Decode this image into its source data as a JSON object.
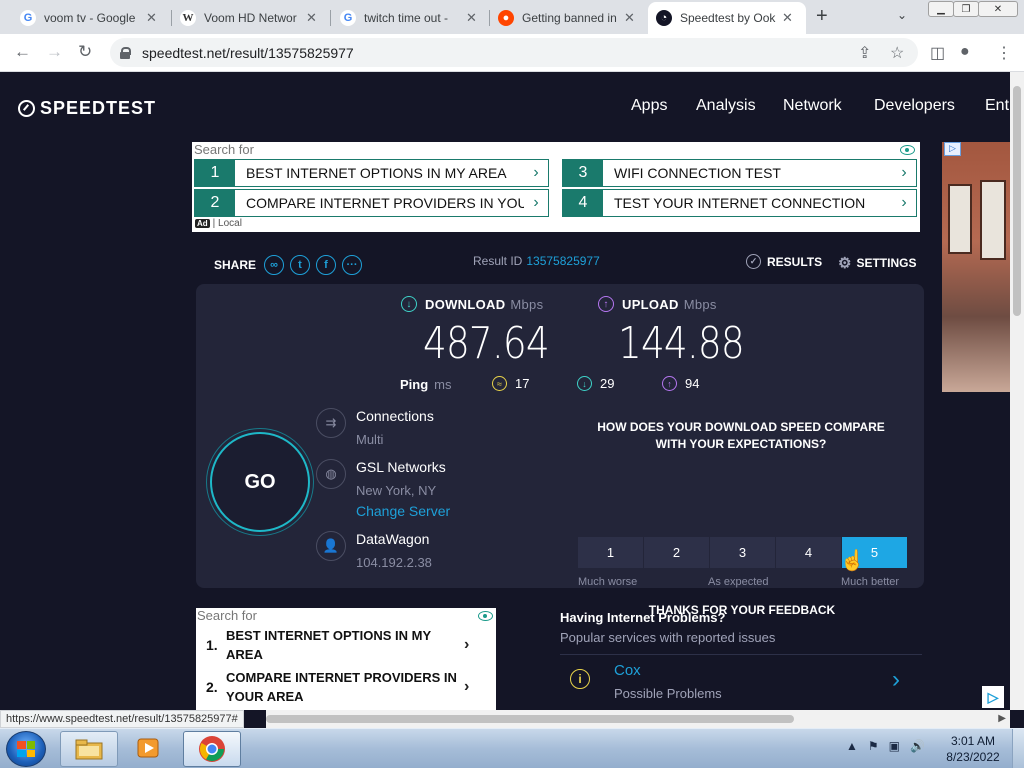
{
  "browser": {
    "tabs": [
      {
        "title": "voom tv - Google",
        "favicon": "google-icon"
      },
      {
        "title": "Voom HD Networ",
        "favicon": "wikipedia-icon"
      },
      {
        "title": "twitch time out - ",
        "favicon": "google-icon"
      },
      {
        "title": "Getting banned in",
        "favicon": "reddit-icon"
      },
      {
        "title": "Speedtest by Ook",
        "favicon": "speedtest-icon"
      }
    ],
    "url": "speedtest.net/result/13575825977",
    "status_url": "https://www.speedtest.net/result/13575825977#"
  },
  "site": {
    "logo": "SPEEDTEST",
    "nav": [
      "Apps",
      "Analysis",
      "Network",
      "Developers",
      "Ent"
    ]
  },
  "ad_top": {
    "search_for": "Search for",
    "items": [
      {
        "num": "1",
        "label": "BEST INTERNET OPTIONS IN MY AREA"
      },
      {
        "num": "2",
        "label": "COMPARE INTERNET PROVIDERS IN YOUR"
      },
      {
        "num": "3",
        "label": "WIFI CONNECTION TEST"
      },
      {
        "num": "4",
        "label": "TEST YOUR INTERNET CONNECTION"
      }
    ],
    "tag_ad": "Ad",
    "tag_local": "| Local"
  },
  "share": {
    "label": "SHARE",
    "result_id_label": "Result ID",
    "result_id": "13575825977",
    "results_label": "RESULTS",
    "settings_label": "SETTINGS"
  },
  "result": {
    "download_label": "DOWNLOAD",
    "upload_label": "UPLOAD",
    "unit": "Mbps",
    "download": "487.64",
    "upload": "144.88",
    "ping_label": "Ping",
    "ping_unit": "ms",
    "ping": "17",
    "ping_down": "29",
    "ping_up": "94",
    "go": "GO",
    "connections_label": "Connections",
    "connections_value": "Multi",
    "server_name": "GSL Networks",
    "server_location": "New York, NY",
    "change_server": "Change Server",
    "isp": "DataWagon",
    "ip": "104.192.2.38"
  },
  "feedback": {
    "question": "HOW DOES YOUR DOWNLOAD SPEED COMPARE WITH YOUR EXPECTATIONS?",
    "options": [
      "1",
      "2",
      "3",
      "4",
      "5"
    ],
    "selected": "5",
    "label_low": "Much worse",
    "label_mid": "As expected",
    "label_high": "Much better",
    "thanks": "THANKS FOR YOUR FEEDBACK"
  },
  "ad_bottom": {
    "search_for": "Search for",
    "items": [
      {
        "num": "1.",
        "label": "BEST INTERNET OPTIONS IN MY AREA"
      },
      {
        "num": "2.",
        "label": "COMPARE INTERNET PROVIDERS IN YOUR AREA"
      }
    ]
  },
  "problems": {
    "heading": "Having Internet Problems?",
    "subheading": "Popular services with reported issues",
    "item_name": "Cox",
    "item_status": "Possible Problems"
  },
  "taskbar": {
    "time": "3:01 AM",
    "date": "8/23/2022"
  }
}
